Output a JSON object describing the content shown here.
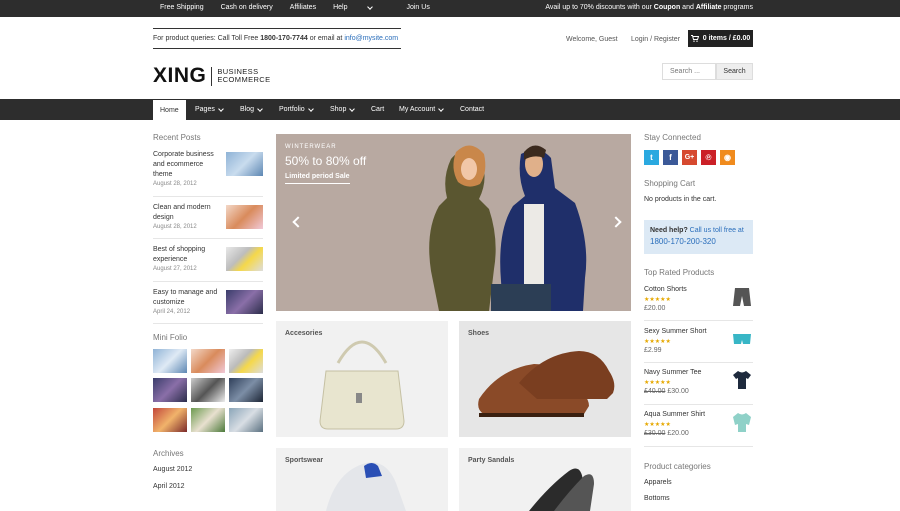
{
  "topbar": {
    "links": [
      "Free Shipping",
      "Cash on delivery",
      "Affiliates",
      "Help",
      "Join Us"
    ],
    "promo_pre": "Avail up to 70% discounts with our ",
    "promo_coupon": "Coupon",
    "promo_and": " and ",
    "promo_affiliate": "Affiliate",
    "promo_post": " programs"
  },
  "header": {
    "query_pre": "For product queries: Call Toll Free ",
    "phone": "1800-170-7744",
    "query_mid": " or email at ",
    "email": "info@mysite.com",
    "logo_main": "XING",
    "logo_sub1": "BUSINESS",
    "logo_sub2": "ECOMMERCE",
    "welcome": "Welcome, Guest",
    "login": "Login / Register",
    "cart": "0 items / £0.00",
    "search_placeholder": "Search ...",
    "search_button": "Search"
  },
  "nav": {
    "items": [
      "Home",
      "Pages",
      "Blog",
      "Portfolio",
      "Shop",
      "Cart",
      "My Account",
      "Contact"
    ]
  },
  "left": {
    "recent_title": "Recent Posts",
    "posts": [
      {
        "title": "Corporate business and ecommerce theme",
        "date": "August 28, 2012"
      },
      {
        "title": "Clean and modern design",
        "date": "August 28, 2012"
      },
      {
        "title": "Best of shopping experience",
        "date": "August 27, 2012"
      },
      {
        "title": "Easy to manage and customize",
        "date": "April 24, 2012"
      }
    ],
    "folio_title": "Mini Folio",
    "archives_title": "Archives",
    "archives": [
      "August 2012",
      "April 2012"
    ]
  },
  "slider": {
    "kicker": "WINTERWEAR",
    "headline": "50% to 80% off",
    "sub": "Limited period Sale"
  },
  "categories": [
    "Accesories",
    "Shoes",
    "Sportswear",
    "Party Sandals"
  ],
  "right": {
    "stay_title": "Stay Connected",
    "cart_title": "Shopping Cart",
    "cart_empty": "No products in the cart.",
    "help_bold": "Need help?",
    "help_text": " Call us toll free at",
    "help_phone": "1800-170-200-320",
    "top_title": "Top Rated Products",
    "products": [
      {
        "name": "Cotton Shorts",
        "stars": "★★★★★",
        "old": "",
        "price": "£20.00"
      },
      {
        "name": "Sexy Summer Short",
        "stars": "★★★★★",
        "old": "",
        "price": "£2.99"
      },
      {
        "name": "Navy Summer Tee",
        "stars": "★★★★★",
        "old": "£40.00",
        "price": "£30.00"
      },
      {
        "name": "Aqua Summer Shirt",
        "stars": "★★★★★",
        "old": "£30.00",
        "price": "£20.00"
      }
    ],
    "cat_title": "Product categories",
    "cats": [
      "Apparels",
      "Bottoms"
    ]
  },
  "icons": {
    "cart": "shopping-cart-icon",
    "twitter": "twitter-icon",
    "facebook": "facebook-icon",
    "gplus": "google-plus-icon",
    "pinterest": "pinterest-icon",
    "rss": "rss-icon"
  },
  "colors": {
    "dark_bar": "#2d2d2d",
    "link_blue": "#2a6ebb",
    "help_bg": "#dce9f5",
    "star": "#e6a800"
  }
}
